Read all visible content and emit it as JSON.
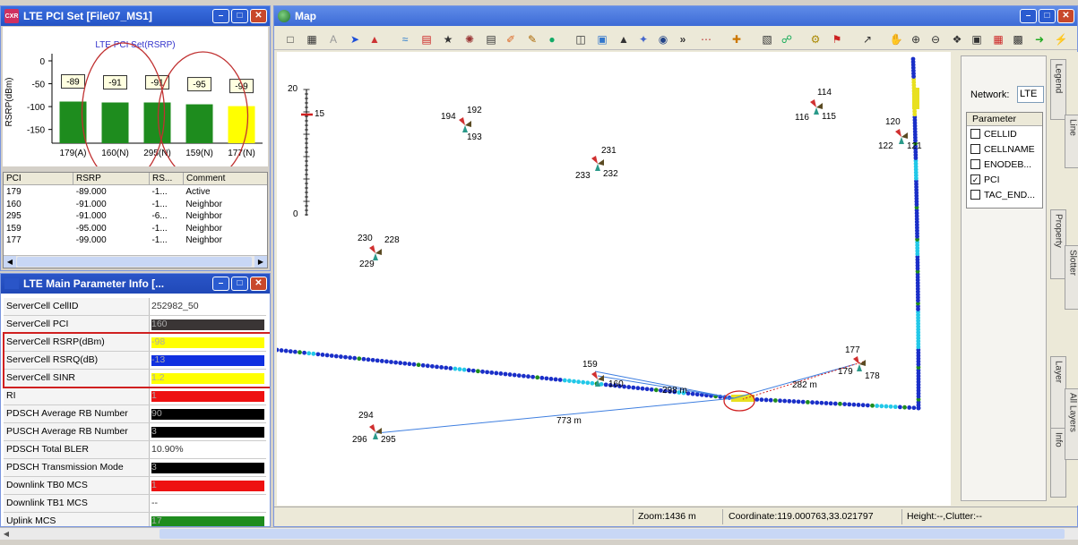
{
  "pci_window": {
    "title": "LTE PCI Set [File07_MS1]",
    "app_logo": "CXR",
    "chart_title": "LTE PCI Set(RSRP)",
    "ylabel": "RSRP(dBm)"
  },
  "chart_data": {
    "type": "bar",
    "title": "LTE PCI Set(RSRP)",
    "ylabel": "RSRP(dBm)",
    "categories": [
      "179(A)",
      "160(N)",
      "295(N)",
      "159(N)",
      "177(N)"
    ],
    "values": [
      -89,
      -91,
      -91,
      -95,
      -99
    ],
    "ylim": [
      -180,
      0
    ],
    "yticks": [
      0,
      -50,
      -100,
      -150
    ],
    "colors": [
      "#1e8c1e",
      "#1e8c1e",
      "#1e8c1e",
      "#1e8c1e",
      "#ffff00"
    ]
  },
  "pci_table": {
    "headers": [
      "PCI",
      "RSRP",
      "RS...",
      "Comment"
    ],
    "rows": [
      [
        "179",
        "-89.000",
        "-1...",
        "Active"
      ],
      [
        "160",
        "-91.000",
        "-1...",
        "Neighbor"
      ],
      [
        "295",
        "-91.000",
        "-6...",
        "Neighbor"
      ],
      [
        "159",
        "-95.000",
        "-1...",
        "Neighbor"
      ],
      [
        "177",
        "-99.000",
        "-1...",
        "Neighbor"
      ]
    ]
  },
  "param_window": {
    "title": "LTE Main Parameter Info [...",
    "rows": [
      {
        "k": "ServerCell CellID",
        "v": "252982_50",
        "c": ""
      },
      {
        "k": "ServerCell PCI",
        "v": "160",
        "c": "#3a3535"
      },
      {
        "k": "ServerCell RSRP(dBm)",
        "v": "-98",
        "c": "#ffff00"
      },
      {
        "k": "ServerCell RSRQ(dB)",
        "v": "-13",
        "c": "#1030e0"
      },
      {
        "k": "ServerCell SINR",
        "v": "1.2",
        "c": "#ffff00"
      },
      {
        "k": "RI",
        "v": "1",
        "c": "#ee1111"
      },
      {
        "k": "PDSCH Average RB Number",
        "v": "90",
        "c": "#000000"
      },
      {
        "k": "PUSCH Average RB Number",
        "v": "3",
        "c": "#000000"
      },
      {
        "k": "PDSCH Total BLER",
        "v": "10.90%",
        "c": ""
      },
      {
        "k": "PDSCH Transmission Mode",
        "v": "3",
        "c": "#000000"
      },
      {
        "k": "Downlink TB0 MCS",
        "v": "1",
        "c": "#ee1111"
      },
      {
        "k": "Downlink TB1 MCS",
        "v": "--",
        "c": ""
      },
      {
        "k": "Uplink MCS",
        "v": "17",
        "c": "#1e8c1e"
      }
    ]
  },
  "map_window": {
    "title": "Map"
  },
  "map": {
    "scale_labels": [
      "20",
      "15",
      "0"
    ],
    "distances": [
      "298 m",
      "773 m",
      "282 m"
    ],
    "sites": [
      {
        "n": "a",
        "labels": [
          "194",
          "192",
          "193"
        ]
      },
      {
        "n": "b",
        "labels": [
          "231",
          "233",
          "232"
        ]
      },
      {
        "n": "c",
        "labels": [
          "230",
          "228",
          "229"
        ]
      },
      {
        "n": "d",
        "labels": [
          "114",
          "116",
          "115"
        ]
      },
      {
        "n": "e",
        "labels": [
          "120",
          "122",
          "121"
        ]
      },
      {
        "n": "f",
        "labels": [
          "177",
          "179",
          "178"
        ]
      },
      {
        "n": "g",
        "labels": [
          "159",
          "160"
        ]
      },
      {
        "n": "h",
        "labels": [
          "294",
          "296",
          "295"
        ]
      }
    ]
  },
  "legend_panel": {
    "network_label": "Network:",
    "network_value": "LTE",
    "param_header": "Parameter",
    "params": [
      {
        "label": "CELLID",
        "checked": false
      },
      {
        "label": "CELLNAME",
        "checked": false
      },
      {
        "label": "ENODEB...",
        "checked": false
      },
      {
        "label": "PCI",
        "checked": true
      },
      {
        "label": "TAC_END...",
        "checked": false
      }
    ],
    "tabs_inner": [
      "Legend",
      "Property",
      "Layer",
      "Info"
    ],
    "tabs_outer": [
      "Line",
      "Slotter",
      "All Layers"
    ]
  },
  "status": {
    "zoom": "Zoom:1436 m",
    "coord": "Coordinate:119.000763,33.021797",
    "height": "Height:--,Clutter:--"
  }
}
